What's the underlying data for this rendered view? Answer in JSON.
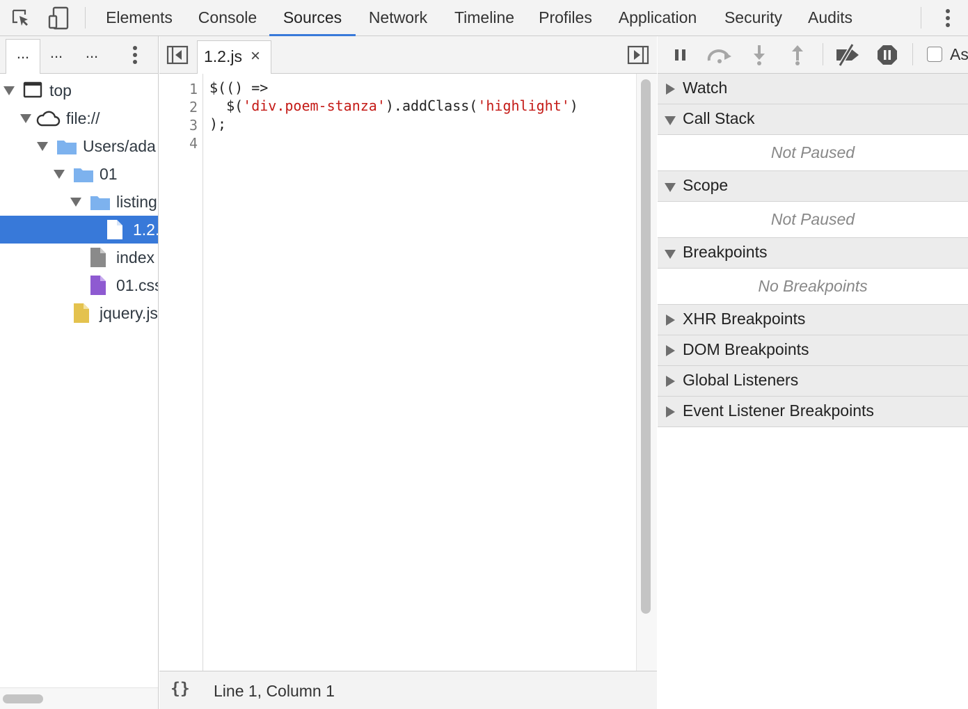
{
  "main_toolbar": {
    "tabs": [
      "Elements",
      "Console",
      "Sources",
      "Network",
      "Timeline",
      "Profiles",
      "Application",
      "Security",
      "Audits"
    ],
    "active_tab": "Sources",
    "accent_color": "#3879d9"
  },
  "navigator": {
    "tabs": [
      "...",
      "...",
      "..."
    ],
    "tree": [
      {
        "label": "top",
        "icon": "frame-icon"
      },
      {
        "label": "file://",
        "icon": "cloud-icon"
      },
      {
        "label": "Users/ada",
        "icon": "folder-icon"
      },
      {
        "label": "01",
        "icon": "folder-icon"
      },
      {
        "label": "listing",
        "icon": "folder-icon"
      },
      {
        "label": "1.2.",
        "icon": "js-file-icon",
        "selected": true
      },
      {
        "label": "index",
        "icon": "html-file-icon"
      },
      {
        "label": "01.css",
        "icon": "css-file-icon"
      },
      {
        "label": "jquery.js",
        "icon": "js-file-icon"
      }
    ]
  },
  "editor": {
    "open_file": "1.2.js",
    "close_glyph": "×",
    "line_numbers": [
      "1",
      "2",
      "3",
      "4"
    ],
    "code_lines": [
      [
        {
          "t": "$(() =>",
          "k": "plain"
        }
      ],
      [
        {
          "t": "  $(",
          "k": "plain"
        },
        {
          "t": "'div.poem-stanza'",
          "k": "str"
        },
        {
          "t": ").addClass(",
          "k": "plain"
        },
        {
          "t": "'highlight'",
          "k": "str"
        },
        {
          "t": ")",
          "k": "plain"
        }
      ],
      [
        {
          "t": ");",
          "k": "plain"
        }
      ],
      [
        {
          "t": "",
          "k": "plain"
        }
      ]
    ],
    "status": {
      "pretty_print": "{}",
      "cursor_position": "Line 1, Column 1"
    }
  },
  "debugger": {
    "toolbar": {
      "async_label": "Async"
    },
    "sections": [
      {
        "title": "Watch",
        "expanded": false
      },
      {
        "title": "Call Stack",
        "expanded": true,
        "message": "Not Paused"
      },
      {
        "title": "Scope",
        "expanded": true,
        "message": "Not Paused"
      },
      {
        "title": "Breakpoints",
        "expanded": true,
        "message": "No Breakpoints"
      },
      {
        "title": "XHR Breakpoints",
        "expanded": false
      },
      {
        "title": "DOM Breakpoints",
        "expanded": false
      },
      {
        "title": "Global Listeners",
        "expanded": false
      },
      {
        "title": "Event Listener Breakpoints",
        "expanded": false
      }
    ]
  }
}
